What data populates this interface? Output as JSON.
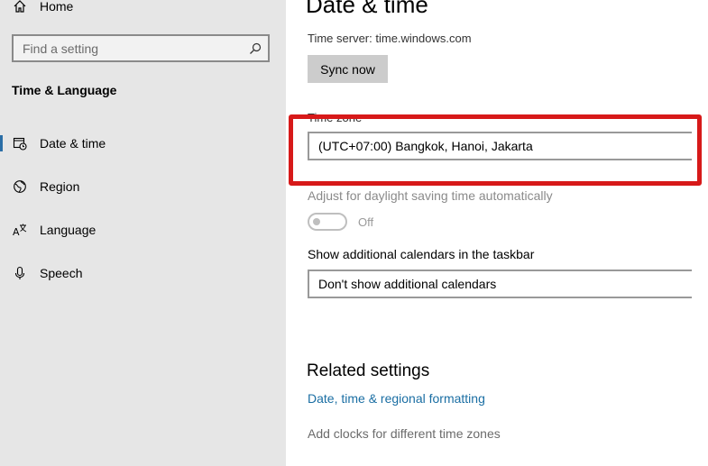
{
  "sidebar": {
    "home_label": "Home",
    "search_placeholder": "Find a setting",
    "section_title": "Time & Language",
    "items": [
      {
        "label": "Date & time",
        "icon": "calendar-clock-icon"
      },
      {
        "label": "Region",
        "icon": "globe-icon"
      },
      {
        "label": "Language",
        "icon": "language-icon"
      },
      {
        "label": "Speech",
        "icon": "microphone-icon"
      }
    ]
  },
  "main": {
    "title": "Date & time",
    "time_server": "Time server: time.windows.com",
    "sync_button": "Sync now",
    "time_zone": {
      "label": "Time zone",
      "selected": "(UTC+07:00) Bangkok, Hanoi, Jakarta"
    },
    "dst": {
      "label": "Adjust for daylight saving time automatically",
      "state": "Off"
    },
    "calendars": {
      "label": "Show additional calendars in the taskbar",
      "selected": "Don't show additional calendars"
    },
    "related": {
      "title": "Related settings",
      "link1": "Date, time & regional formatting",
      "link2": "Add clocks for different time zones"
    }
  },
  "colors": {
    "sidebar_bg": "#e6e6e6",
    "accent": "#2b6ea6",
    "link": "#1a6ea3",
    "highlight": "#d71919"
  }
}
